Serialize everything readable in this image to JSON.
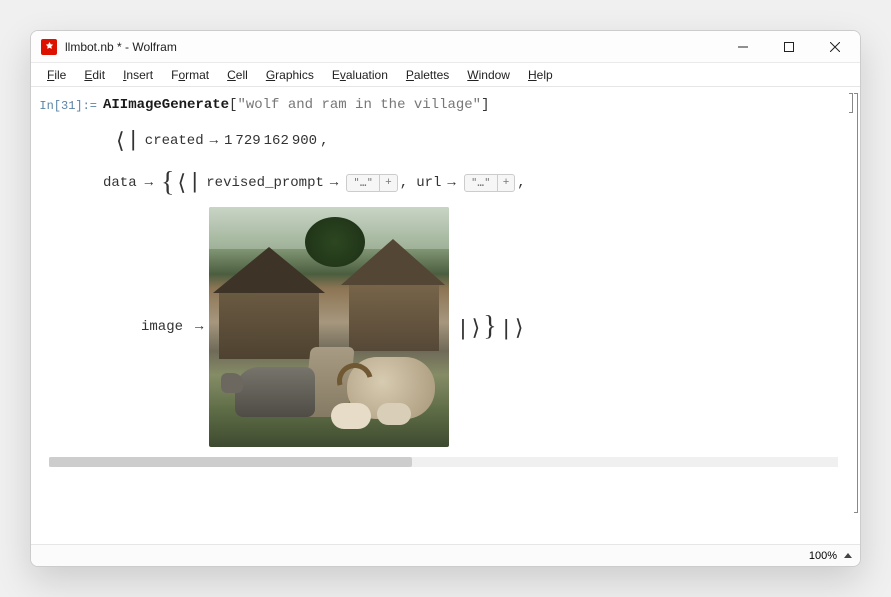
{
  "window": {
    "title": "llmbot.nb * - Wolfram"
  },
  "menu": {
    "file": "File",
    "edit": "Edit",
    "insert": "Insert",
    "format": "Format",
    "cell": "Cell",
    "graphics": "Graphics",
    "evaluation": "Evaluation",
    "palettes": "Palettes",
    "window": "Window",
    "help": "Help"
  },
  "input": {
    "label": "In[31]:=",
    "function": "AIImageGenerate",
    "open_bracket": "[",
    "string": "\"wolf and ram in the village\"",
    "close_bracket": "]"
  },
  "output": {
    "assoc_open": "⟨",
    "pipe": "|",
    "created_key": "created",
    "arrow": "→",
    "created_value_parts": [
      "1",
      "729",
      "162",
      "900"
    ],
    "comma": ",",
    "data_key": "data",
    "list_open": "{",
    "revised_prompt_key": "revised_prompt",
    "elision": "\"…\"",
    "elision_plus": "+",
    "url_key": "url",
    "image_key": "image",
    "list_close": "}",
    "assoc_close": "⟩"
  },
  "status": {
    "zoom": "100%"
  }
}
